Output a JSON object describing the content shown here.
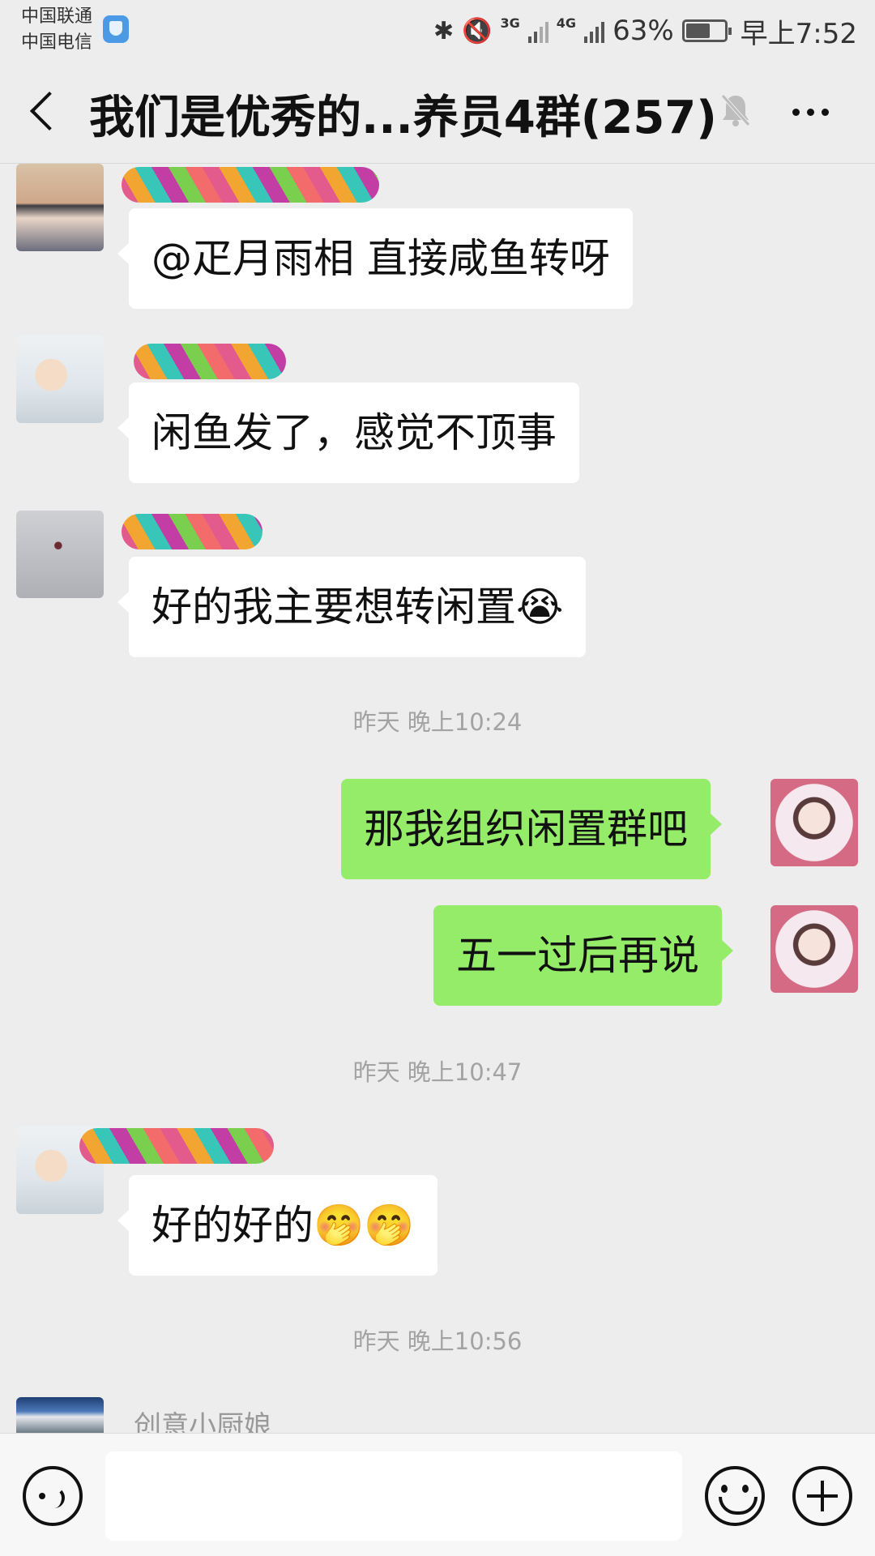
{
  "status_bar": {
    "carrier_1": "中国联通",
    "carrier_2": "中国电信",
    "net_1": "3G",
    "net_2": "4G",
    "battery_percent": "63%",
    "battery_level": 0.63,
    "time": "早上7:52"
  },
  "nav": {
    "title": "我们是优秀的...养员4群(257)",
    "icons": [
      "back-icon",
      "mute-icon",
      "more-icon"
    ]
  },
  "messages": [
    {
      "side": "incoming",
      "text": "@疋月雨相  直接咸鱼转呀"
    },
    {
      "side": "incoming",
      "text": "闲鱼发了，感觉不顶事"
    },
    {
      "side": "incoming",
      "text": "好的我主要想转闲置😭"
    },
    {
      "side": "outgoing",
      "text": "那我组织闲置群吧"
    },
    {
      "side": "outgoing",
      "text": "五一过后再说"
    },
    {
      "side": "incoming",
      "text": "好的好的🤭🤭"
    }
  ],
  "timestamps": [
    "昨天 晚上10:24",
    "昨天 晚上10:47",
    "昨天 晚上10:56"
  ],
  "partial_sender": "创意小厨娘",
  "input_bar": {
    "input_value": "",
    "icons": [
      "voice-icon",
      "emoji-icon",
      "plus-icon"
    ]
  },
  "colors": {
    "background": "#ededed",
    "outgoing_bubble": "#95ec69",
    "incoming_bubble": "#ffffff",
    "timestamp_text": "#a3a3a3"
  }
}
